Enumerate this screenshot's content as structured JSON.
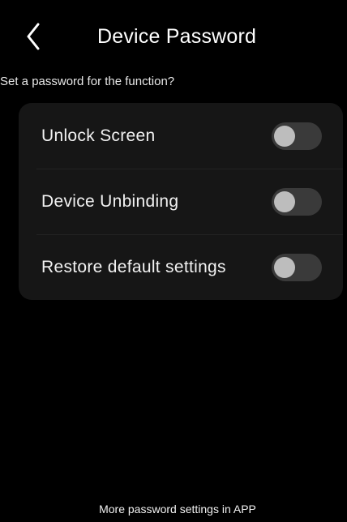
{
  "header": {
    "title": "Device Password",
    "back_icon": "chevron-left-icon"
  },
  "subtitle": "Set a password for the function?",
  "settings": [
    {
      "label": "Unlock Screen",
      "enabled": false
    },
    {
      "label": "Device Unbinding",
      "enabled": false
    },
    {
      "label": "Restore default settings",
      "enabled": false
    }
  ],
  "footer": {
    "link_text": "More password settings in APP"
  },
  "colors": {
    "background": "#000000",
    "card": "#161616",
    "toggle_track_off": "#3a3a3a",
    "toggle_knob_off": "#bdbdbd",
    "text": "#ffffff"
  }
}
